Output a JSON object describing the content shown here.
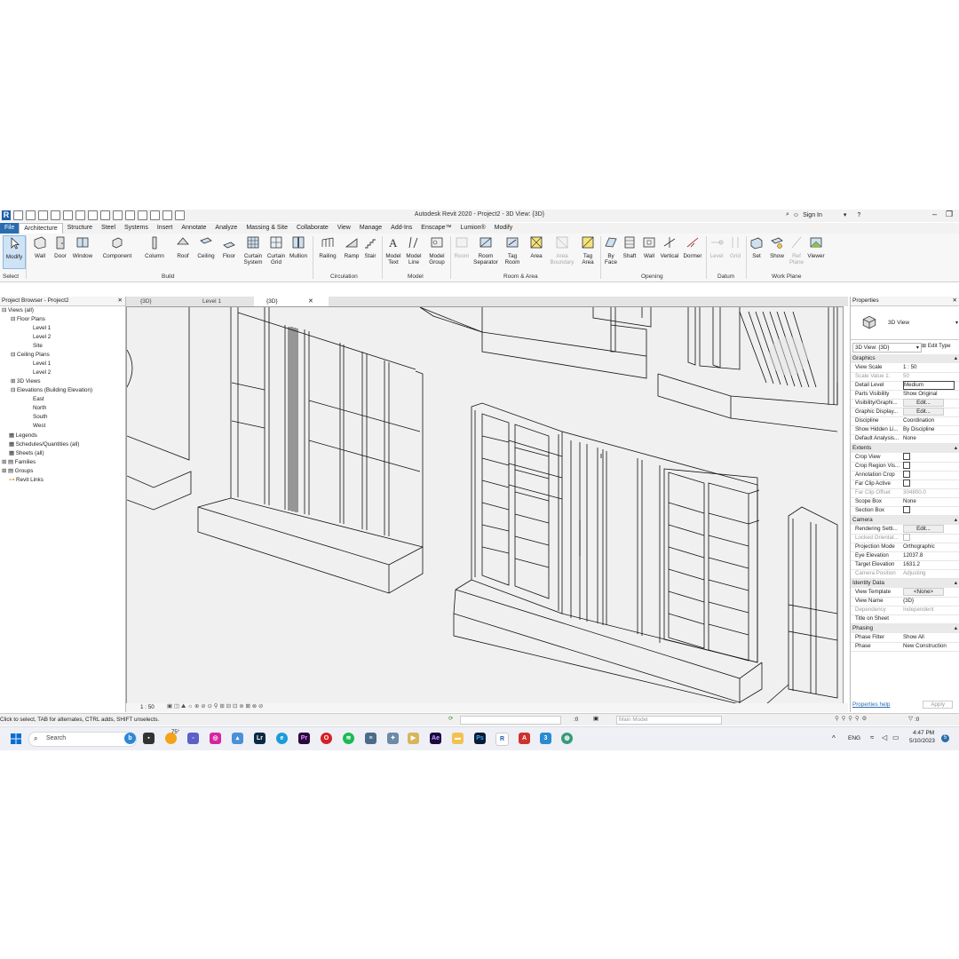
{
  "titlebar": {
    "app_title": "Autodesk Revit 2020 - Project2 - 3D View: {3D}",
    "sign_in": "Sign In"
  },
  "ribbon_tabs": [
    "File",
    "Architecture",
    "Structure",
    "Steel",
    "Systems",
    "Insert",
    "Annotate",
    "Analyze",
    "Massing & Site",
    "Collaborate",
    "View",
    "Manage",
    "Add-Ins",
    "Enscape™",
    "Lumion®",
    "Modify"
  ],
  "ribbon": {
    "select_label": "Select",
    "panels": {
      "build": "Build",
      "circulation": "Circulation",
      "model": "Model",
      "room_area": "Room & Area",
      "opening": "Opening",
      "datum": "Datum",
      "work_plane": "Work Plane"
    },
    "tools": {
      "modify": "Modify",
      "wall": "Wall",
      "door": "Door",
      "window": "Window",
      "component": "Component",
      "column": "Column",
      "roof": "Roof",
      "ceiling": "Ceiling",
      "floor": "Floor",
      "curtain_system_1": "Curtain",
      "curtain_system_2": "System",
      "curtain_grid_1": "Curtain",
      "curtain_grid_2": "Grid",
      "mullion": "Mullion",
      "railing": "Railing",
      "ramp": "Ramp",
      "stair": "Stair",
      "model_text_1": "Model",
      "model_text_2": "Text",
      "model_line_1": "Model",
      "model_line_2": "Line",
      "model_group_1": "Model",
      "model_group_2": "Group",
      "room": "Room",
      "room_sep_1": "Room",
      "room_sep_2": "Separator",
      "tag_room_1": "Tag",
      "tag_room_2": "Room",
      "area": "Area",
      "area_boundary_1": "Area",
      "area_boundary_2": "Boundary",
      "tag_area_1": "Tag",
      "tag_area_2": "Area",
      "by_face_1": "By",
      "by_face_2": "Face",
      "shaft": "Shaft",
      "op_wall": "Wall",
      "vertical": "Vertical",
      "dormer": "Dormer",
      "level": "Level",
      "grid": "Grid",
      "set": "Set",
      "show": "Show",
      "ref_plane_1": "Ref",
      "ref_plane_2": "Plane",
      "viewer": "Viewer"
    }
  },
  "project_browser": {
    "title": "Project Browser - Project2",
    "items": [
      "Views (all)",
      "Floor Plans",
      "Level 1",
      "Level 2",
      "Site",
      "Ceiling Plans",
      "Level 1",
      "Level 2",
      "3D Views",
      "Elevations (Building Elevation)",
      "East",
      "North",
      "South",
      "West",
      "Legends",
      "Schedules/Quantities (all)",
      "Sheets (all)",
      "Families",
      "Groups",
      "Revit Links"
    ]
  },
  "view_tabs": [
    "{3D}",
    "Level 1",
    "{3D}"
  ],
  "view_bar": {
    "scale": "1 : 50"
  },
  "properties": {
    "title": "Properties",
    "type_name": "3D View",
    "instance_selector": "3D View: {3D}",
    "edit_type": "Edit Type",
    "sections": {
      "graphics": "Graphics",
      "extents": "Extents",
      "camera": "Camera",
      "identity": "Identity Data",
      "phasing": "Phasing"
    },
    "rows": {
      "view_scale": [
        "View Scale",
        "1 : 50"
      ],
      "scale_value": [
        "Scale Value    1:",
        "50"
      ],
      "detail_level": [
        "Detail Level",
        "Medium"
      ],
      "parts_visibility": [
        "Parts Visibility",
        "Show Original"
      ],
      "vis_graphics": [
        "Visibility/Graphi...",
        "Edit..."
      ],
      "graphic_display": [
        "Graphic Display...",
        "Edit..."
      ],
      "discipline": [
        "Discipline",
        "Coordination"
      ],
      "show_hidden": [
        "Show Hidden Li...",
        "By Discipline"
      ],
      "default_analysis": [
        "Default Analysis...",
        "None"
      ],
      "crop_view": [
        "Crop View",
        ""
      ],
      "crop_region": [
        "Crop Region Vis...",
        ""
      ],
      "annotation_crop": [
        "Annotation Crop",
        ""
      ],
      "far_clip_active": [
        "Far Clip Active",
        ""
      ],
      "far_clip_offset": [
        "Far Clip Offset",
        "304800.0"
      ],
      "scope_box": [
        "Scope Box",
        "None"
      ],
      "section_box": [
        "Section Box",
        ""
      ],
      "rendering": [
        "Rendering Setti...",
        "Edit..."
      ],
      "locked_orient": [
        "Locked Orientat...",
        ""
      ],
      "projection_mode": [
        "Projection Mode",
        "Orthographic"
      ],
      "eye_elevation": [
        "Eye Elevation",
        "12037.8"
      ],
      "target_elevation": [
        "Target Elevation",
        "1631.2"
      ],
      "camera_position": [
        "Camera Position",
        "Adjusting"
      ],
      "view_template": [
        "View Template",
        "<None>"
      ],
      "view_name": [
        "View Name",
        "{3D}"
      ],
      "dependency": [
        "Dependency",
        "Independent"
      ],
      "title_on_sheet": [
        "Title on Sheet",
        ""
      ],
      "phase_filter": [
        "Phase Filter",
        "Show All"
      ],
      "phase": [
        "Phase",
        "New Construction"
      ]
    },
    "help_link": "Properties help",
    "apply": "Apply"
  },
  "status": {
    "message": "Click to select, TAB for alternates, CTRL adds, SHIFT unselects.",
    "workset_value": ":0",
    "main_model": "Main Model",
    "filter_count": ":0"
  },
  "taskbar": {
    "search": "Search",
    "weather": "75°",
    "language": "ENG",
    "time": "4:47 PM",
    "date": "5/10/2023",
    "notif_count": "5"
  },
  "colors": {
    "accent": "#2b6cb0",
    "revit_blue": "#1b5ea8"
  }
}
